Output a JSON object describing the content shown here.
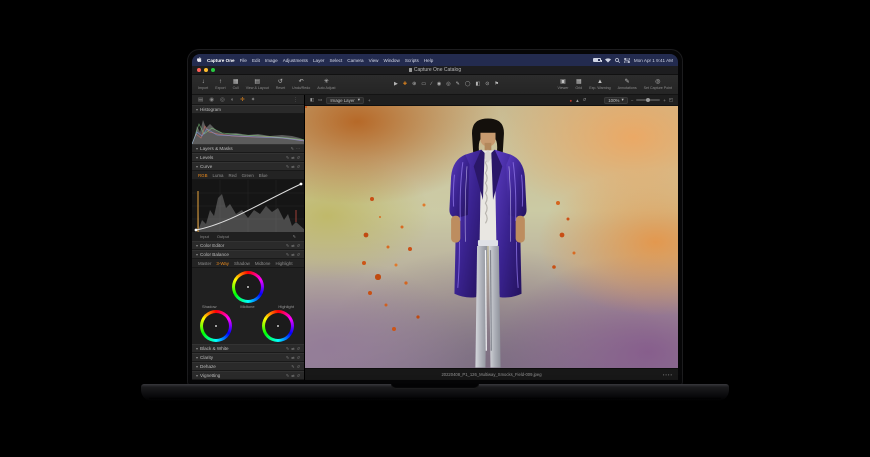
{
  "menu_bar": {
    "app_name": "Capture One",
    "items": [
      "File",
      "Edit",
      "Image",
      "Adjustments",
      "Layer",
      "Select",
      "Camera",
      "View",
      "Window",
      "Scripts",
      "Help"
    ],
    "clock": "Mon Apr 1  9:41 AM"
  },
  "window": {
    "title": "Capture One Catalog"
  },
  "toolbar": {
    "left": [
      {
        "label": "Import"
      },
      {
        "label": "Export"
      },
      {
        "label": "Cull"
      },
      {
        "label": "View & Layout"
      },
      {
        "label": "Reset"
      },
      {
        "label": "Undo/Redo"
      },
      {
        "label": "Auto Adjust"
      }
    ],
    "right": [
      {
        "label": "Viewer"
      },
      {
        "label": "Grid"
      },
      {
        "label": "Exp. Warning"
      },
      {
        "label": "Annotations"
      },
      {
        "label": "Set Capture Point"
      }
    ]
  },
  "viewer_bar": {
    "layer_dropdown": "Image Layer",
    "zoom_value": "100%"
  },
  "panel": {
    "sections": {
      "histogram": "Histogram",
      "layers": "Layers & Masks",
      "levels": "Levels",
      "curve": "Curve",
      "color_editor": "Color Editor",
      "color_balance": "Color Balance",
      "bw": "Black & White",
      "clarity": "Clarity",
      "dehaze": "Dehaze",
      "vignetting": "Vignetting"
    },
    "curve_tabs": [
      "RGB",
      "Luma",
      "Red",
      "Green",
      "Blue"
    ],
    "curve_footer": {
      "left": "Input",
      "right": "Output"
    },
    "balance_tabs": [
      "Master",
      "3-Way",
      "Shadow",
      "Midtone",
      "Highlight"
    ],
    "wheel_labels": [
      "Shadow",
      "Midtone",
      "Highlight"
    ]
  },
  "viewer": {
    "filename": "20220408_P1_126_Multiway_Smocks_Field-009.jpeg"
  },
  "icons": {
    "disclosure_open": "▾",
    "brush": "✎",
    "copy_apply": "⇄",
    "reset": "↺",
    "more": "⋯",
    "import": "↓",
    "export": "↑",
    "cull": "▦",
    "view_layout": "▤",
    "reset_tool": "↺",
    "undo": "↶",
    "auto_adjust": "✳",
    "viewer_toggle": "▣",
    "grid": "▦",
    "exp_warning": "▲",
    "annotations": "✎",
    "capture_point": "◎",
    "tool_pointer": "▶",
    "tool_pan": "✚",
    "tool_zoom": "⊕",
    "tool_crop": "▭",
    "tool_straighten": "∕",
    "tool_heal": "◉",
    "tool_clone": "◎",
    "tool_draw_mask": "✎",
    "tool_erase_mask": "◯",
    "tool_gradient": "◧",
    "tool_radial": "⊙",
    "tool_flag": "⚑",
    "tab_library": "▤",
    "tab_capture": "◉",
    "tab_lens": "◎",
    "tab_color": "◐",
    "tab_adjust": "✛",
    "tab_style": "✦",
    "panel_more": "⋮",
    "compare": "◧",
    "proof": "●",
    "focus_mask": "▲",
    "plus": "+",
    "minus": "−",
    "chevron_down": "▾",
    "fit_screen": "◰",
    "picker": "✎",
    "nav_dots": "▪ ▪ ▪ ▪"
  },
  "colors": {
    "accent": "#e8891d",
    "menu_bar": "#232b4f",
    "traffic_red": "#ff5f57",
    "traffic_yellow": "#febc2e",
    "traffic_green": "#28c840"
  }
}
